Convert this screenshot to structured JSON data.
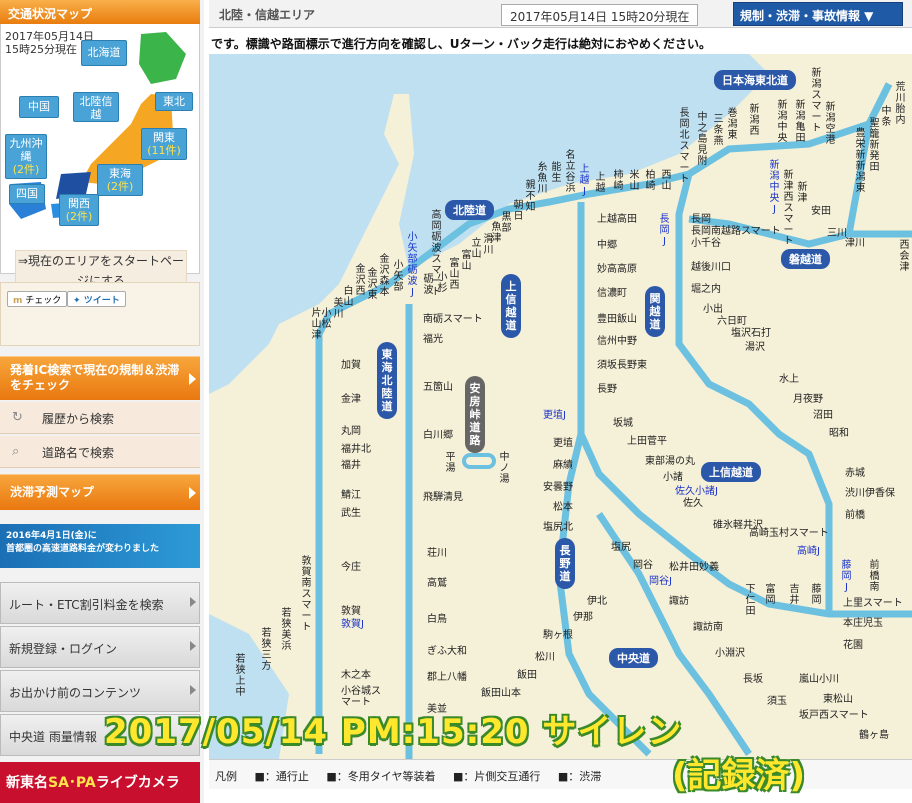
{
  "sidebar": {
    "header": "交通状況マップ",
    "mini_date": "2017年05月14日",
    "mini_time": "15時25分現在",
    "regions": [
      {
        "name": "北海道",
        "count": ""
      },
      {
        "name": "東北",
        "count": ""
      },
      {
        "name": "中国",
        "count": ""
      },
      {
        "name": "北陸信越",
        "count": ""
      },
      {
        "name": "関東",
        "count": "(11件)"
      },
      {
        "name": "九州沖縄",
        "count": "(2件)"
      },
      {
        "name": "東海",
        "count": "(2件)"
      },
      {
        "name": "四国",
        "count": ""
      },
      {
        "name": "関西",
        "count": "(2件)"
      }
    ],
    "start_link": "⇒現在のエリアをスタートページにする",
    "share_check": "チェック",
    "share_tweet": "ツイート",
    "ic_search": "発着IC検索で現在の規制＆渋滞をチェック",
    "history_search": "履歴から検索",
    "road_search": "道路名で検索",
    "jam_forecast": "渋滞予測マップ",
    "banner_line1": "2016年4月1日(金)に",
    "banner_line2": "首都圏の高速道路料金が変わりました",
    "route_btn": "ルート・ETC割引料金を検索",
    "login_btn": "新規登録・ログイン",
    "contents_btn": "お出かけ前のコンテンツ",
    "rain_btn": "中央道 雨量情報",
    "sa_banner_a": "新東名",
    "sa_banner_b": "SA･PA",
    "sa_banner_c": "ライブカメラ"
  },
  "main": {
    "area_title": "北陸・信越エリア",
    "area_time": "2017年05月14日 15時20分現在",
    "info_button": "規制・渋滞・事故情報 ▼",
    "ticker": "です。標識や路面標示で進行方向を確認し、Uターン・バック走行は絶対におやめください。",
    "roads": {
      "nihonkai": "日本海東北道",
      "hokuriku": "北陸道",
      "joshinetsu1": "上信越道",
      "kanetsu": "関越道",
      "tokaihokuriku": "東海北陸道",
      "abo": "安房峠道路",
      "joshinetsu2": "上信越道",
      "nagano": "長野道",
      "chuo": "中央道",
      "bandai": "磐越道"
    },
    "places": {
      "p1": "荒川胎内",
      "p2": "中条",
      "p3": "聖籠新発田",
      "p4": "豊栄新新潟東",
      "p5": "新潟空港",
      "p6": "新潟スマート",
      "p7": "新潟亀田",
      "p8": "新潟中央",
      "p9": "新潟西",
      "p10": "巻潟東",
      "p11": "三条燕",
      "p12": "中之島見附",
      "p13": "長岡北スマート",
      "p14": "西山",
      "p15": "柏崎",
      "p16": "米山",
      "p17": "柿崎",
      "p18": "上越",
      "p19": "上越J",
      "p20": "名立谷浜",
      "p21": "能生",
      "p22": "糸魚川",
      "p23": "親不知",
      "p24": "朝日",
      "p25": "黒部",
      "p26": "魚津",
      "p27": "滑川",
      "p28": "立山",
      "p29": "富山",
      "p30": "小杉",
      "p31": "富山西",
      "p32": "砺波",
      "p33": "小矢部砺波J",
      "p34": "高岡砺波スマート",
      "p35": "小矢部",
      "p36": "金沢森本",
      "p37": "金沢東",
      "p38": "金沢西",
      "p39": "白山",
      "p40": "美川",
      "p41": "小松",
      "p42": "片山津",
      "p43": "加賀",
      "p44": "金津",
      "p45": "丸岡",
      "p46": "福井北",
      "p47": "福井",
      "p48": "鯖江",
      "p49": "武生",
      "p50": "今庄",
      "p51": "敦賀南スマート",
      "p52": "敦賀",
      "p53": "敦賀J",
      "p54": "若狭美浜",
      "p55": "若狭三方",
      "p56": "若狭上中",
      "p57": "南砺スマート",
      "p58": "福光",
      "p59": "五箇山",
      "p60": "白川郷",
      "p61": "飛騨清見",
      "p62": "荘川",
      "p63": "高鷲",
      "p64": "白鳥",
      "p65": "ぎふ大和",
      "p66": "郡上八幡",
      "p67": "美並",
      "p68": "木之本",
      "p69": "小谷城スマート",
      "p70": "平湯",
      "p71": "中ノ湯",
      "p72": "上越高田",
      "p73": "中郷",
      "p74": "妙高高原",
      "p75": "信濃町",
      "p76": "豊田飯山",
      "p77": "信州中野",
      "p78": "須坂長野東",
      "p79": "長野",
      "p80": "更埴J",
      "p81": "更埴",
      "p82": "麻績",
      "p83": "安曇野",
      "p84": "松本",
      "p85": "塩尻北",
      "p86": "塩尻",
      "p87": "岡谷",
      "p88": "岡谷J",
      "p89": "伊北",
      "p90": "伊那",
      "p91": "駒ヶ根",
      "p92": "松川",
      "p93": "飯田",
      "p94": "飯田山本",
      "p95": "坂城",
      "p96": "上田菅平",
      "p97": "東部湯の丸",
      "p98": "小諸",
      "p99": "佐久小諸J",
      "p100": "佐久",
      "p101": "碓氷軽井沢",
      "p102": "諏訪",
      "p103": "松井田妙義",
      "p104": "諏訪南",
      "p105": "小淵沢",
      "p106": "長坂",
      "p107": "須玉",
      "p108": "長岡J",
      "p109": "長岡",
      "p110": "長岡南越路スマート",
      "p111": "小千谷",
      "p112": "越後川口",
      "p113": "堀之内",
      "p114": "小出",
      "p115": "六日町",
      "p116": "塩沢石打",
      "p117": "湯沢",
      "p118": "水上",
      "p119": "月夜野",
      "p120": "沼田",
      "p121": "昭和",
      "p122": "赤城",
      "p123": "渋川伊香保",
      "p124": "前橋",
      "p125": "高崎J",
      "p126": "高崎玉村スマート",
      "p127": "藤岡J",
      "p128": "上里スマート",
      "p129": "本庄児玉",
      "p130": "花園",
      "p131": "新潟中央J",
      "p132": "新津西スマート",
      "p133": "新津",
      "p134": "安田",
      "p135": "三川",
      "p136": "津川",
      "p137": "西会津",
      "p138": "下仁田",
      "p139": "富岡",
      "p140": "吉井",
      "p141": "藤岡",
      "p142": "前橋南",
      "p143": "嵐山小川",
      "p144": "東松山",
      "p145": "坂戸西スマート",
      "p146": "鶴ヶ島"
    },
    "legend": {
      "label": "凡例",
      "item1": "■：通行止",
      "item2": "■：冬用タイヤ等装着",
      "item3": "■：片側交互通行",
      "item4": "■：渋滞"
    },
    "overlay_line1": "2017/05/14 PM:15:20 サイレン",
    "overlay_line2": "(記録済)"
  },
  "colors": {
    "road": "#6cc0e0",
    "sea": "#bfe0f0",
    "land": "#f5f0d8",
    "pill": "#2b58a8",
    "sidebar_orange": "#e9780f"
  }
}
